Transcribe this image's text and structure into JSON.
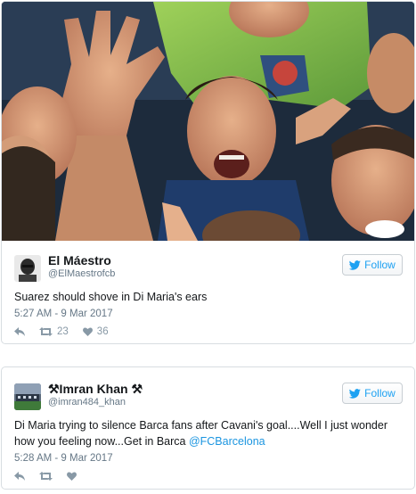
{
  "tweets": [
    {
      "display_name": "El Máestro",
      "handle": "@ElMaestrofcb",
      "follow_label": "Follow",
      "text": "Suarez should shove in Di Maria's ears",
      "timestamp": "5:27 AM - 9 Mar 2017",
      "retweets": "23",
      "likes": "36"
    },
    {
      "display_name": "⚒Imran Khan ⚒",
      "handle": "@imran484_khan",
      "follow_label": "Follow",
      "text_before_mention": "Di Maria trying to silence Barca fans after Cavani's goal....Well I just wonder how you feeling now...Get in Barca ",
      "mention": "@FCBarcelona",
      "timestamp": "5:28 AM - 9 Mar 2017"
    }
  ],
  "colors": {
    "twitter_blue": "#1da1f2",
    "link_blue": "#1b95e0",
    "meta_gray": "#657786",
    "border": "#d8dde1"
  },
  "icons": [
    "twitter-bird-icon",
    "reply-icon",
    "retweet-icon",
    "heart-icon"
  ]
}
